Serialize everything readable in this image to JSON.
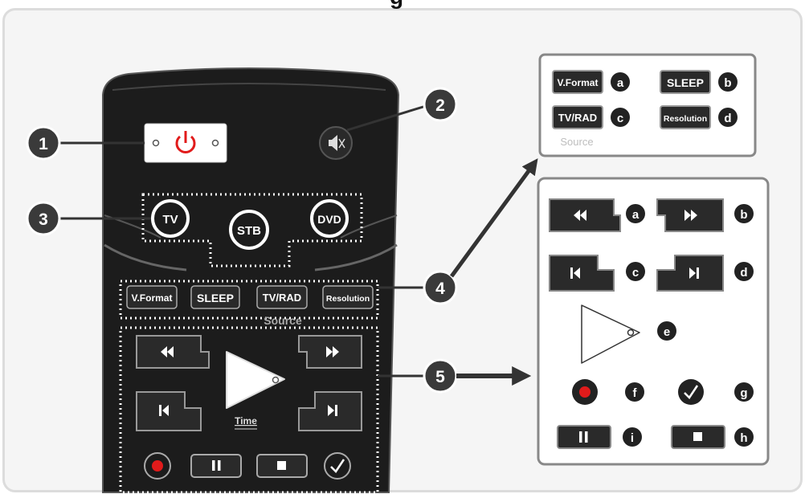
{
  "colors": {
    "remote_body": "#1c1c1c",
    "button_face": "#2a2a2a",
    "accent_red": "#e11b1b",
    "callout": "#3a3a3a",
    "source_label": "#bdbdbd"
  },
  "callouts": [
    "1",
    "2",
    "3",
    "4",
    "5"
  ],
  "remote": {
    "source_keys": [
      "TV",
      "STB",
      "DVD"
    ],
    "function_keys": [
      "V.Format",
      "SLEEP",
      "TV/RAD",
      "Resolution"
    ],
    "source_label": "Source",
    "time_label": "Time"
  },
  "panel_top": {
    "keys": [
      {
        "label": "V.Format",
        "letter": "a"
      },
      {
        "label": "SLEEP",
        "letter": "b"
      },
      {
        "label": "TV/RAD",
        "letter": "c"
      },
      {
        "label": "Resolution",
        "letter": "d"
      }
    ],
    "source_label": "Source"
  },
  "panel_bottom": {
    "letters": [
      "a",
      "b",
      "c",
      "d",
      "e",
      "f",
      "g",
      "i",
      "h"
    ]
  }
}
